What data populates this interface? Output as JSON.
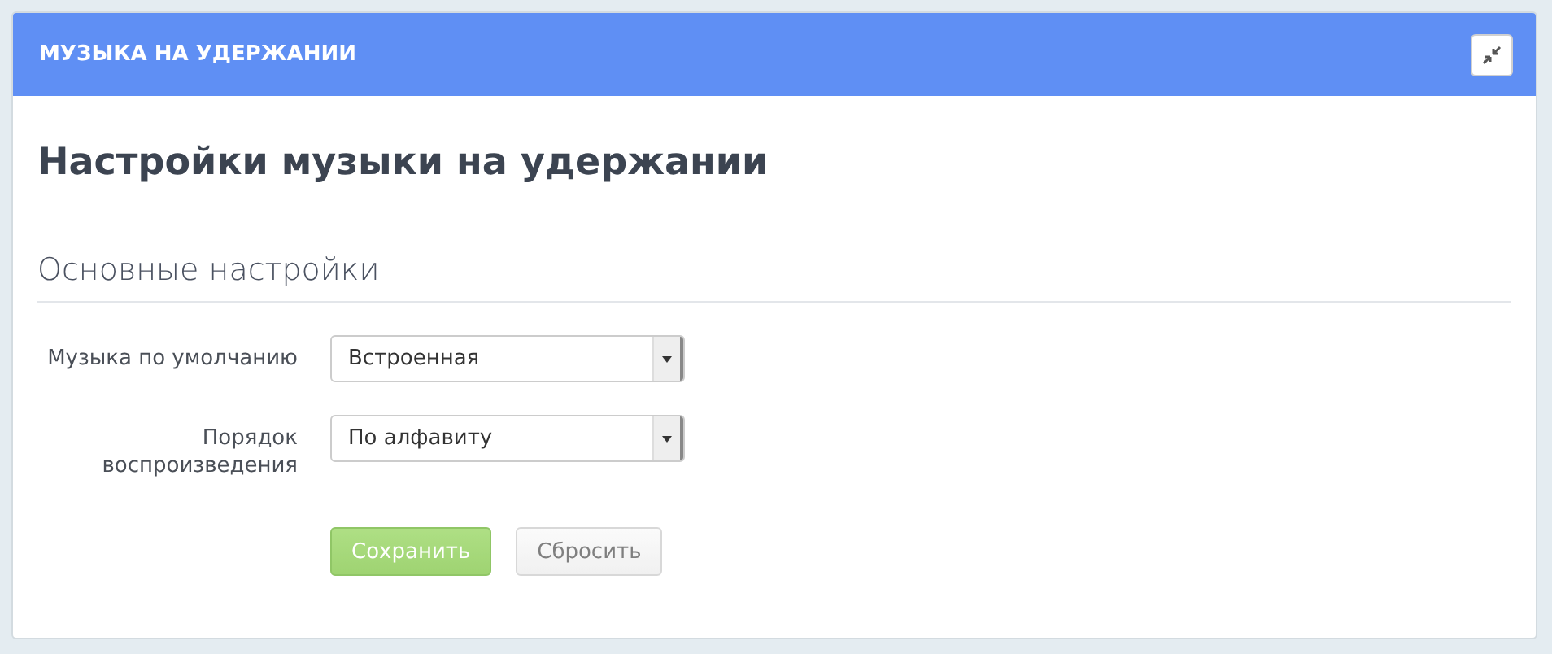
{
  "window": {
    "title": "МУЗЫКА НА УДЕРЖАНИИ"
  },
  "page_title": "Настройки музыки на удержании",
  "section": {
    "title": "Основные настройки"
  },
  "fields": [
    {
      "label": "Музыка по умолчанию",
      "value": "Встроенная"
    },
    {
      "label": "Порядок воспроизведения",
      "value": "По алфавиту"
    }
  ],
  "buttons": [
    {
      "kind": "primary",
      "label": "Сохранить",
      "disabled": true
    },
    {
      "kind": "secondary",
      "label": "Сбросить",
      "disabled": true
    }
  ]
}
